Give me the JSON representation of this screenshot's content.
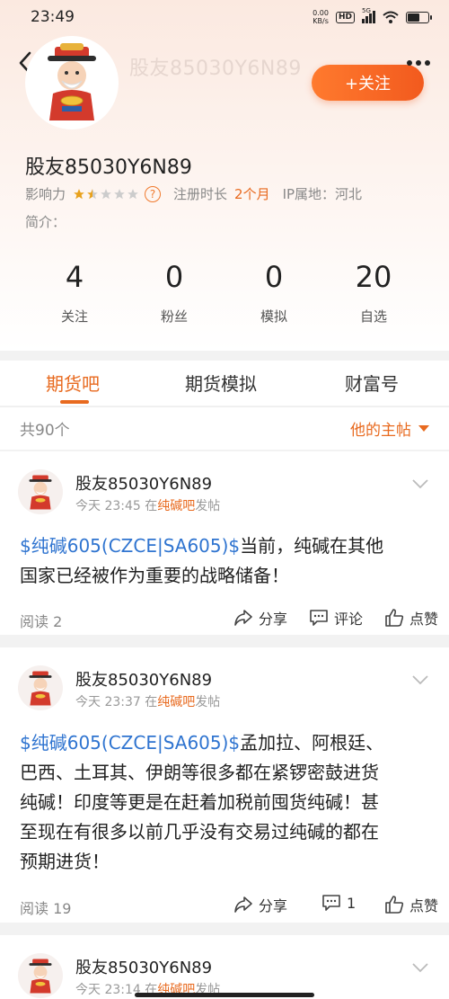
{
  "status": {
    "time": "23:49",
    "net_speed_value": "0.00",
    "net_speed_unit": "KB/s",
    "hd": "HD",
    "signal": "5G"
  },
  "header": {
    "ghost_name": "股友85030Y6N89",
    "follow_label": "+关注",
    "name": "股友85030Y6N89",
    "influence_label": "影响力",
    "influence_stars": 1.5,
    "register_label": "注册时长",
    "register_value": "2个月",
    "ip_label": "IP属地：河北",
    "intro_label": "简介："
  },
  "stats": [
    {
      "value": "4",
      "label": "关注"
    },
    {
      "value": "0",
      "label": "粉丝"
    },
    {
      "value": "0",
      "label": "模拟"
    },
    {
      "value": "20",
      "label": "自选"
    }
  ],
  "tabs": [
    "期货吧",
    "期货模拟",
    "财富号"
  ],
  "filter": {
    "count": "共90个",
    "selected": "他的主帖"
  },
  "posts": [
    {
      "user": "股友85030Y6N89",
      "time": "今天 23:45",
      "in_label": "在",
      "bar": "纯碱吧",
      "posted": "发帖",
      "tag": "$纯碱605(CZCE|SA605)$",
      "text_line1": "当前，纯碱在其他",
      "text_rest": "国家已经被作为重要的战略储备！",
      "read": "阅读 2",
      "share": "分享",
      "comment": "评论",
      "like": "点赞"
    },
    {
      "user": "股友85030Y6N89",
      "time": "今天 23:37",
      "in_label": "在",
      "bar": "纯碱吧",
      "posted": "发帖",
      "tag": "$纯碱605(CZCE|SA605)$",
      "text_line1": "孟加拉、阿根廷、",
      "text_line2": "巴西、土耳其、伊朗等很多都在紧锣密鼓进货",
      "text_line3": "纯碱！印度等更是在赶着加税前囤货纯碱！甚",
      "text_line4": "至现在有很多以前几乎没有交易过纯碱的都在",
      "text_line5": "预期进货！",
      "read": "阅读 19",
      "share": "分享",
      "comment": "1",
      "like": "点赞"
    },
    {
      "user": "股友85030Y6N89",
      "time": "今天 23:14",
      "in_label": "在",
      "bar": "纯碱吧",
      "posted": "发帖"
    }
  ],
  "colors": {
    "accent": "#e86a1f",
    "link": "#2f74d0",
    "follow_gradient_start": "#ff7a2e",
    "follow_gradient_end": "#f25a1e"
  }
}
